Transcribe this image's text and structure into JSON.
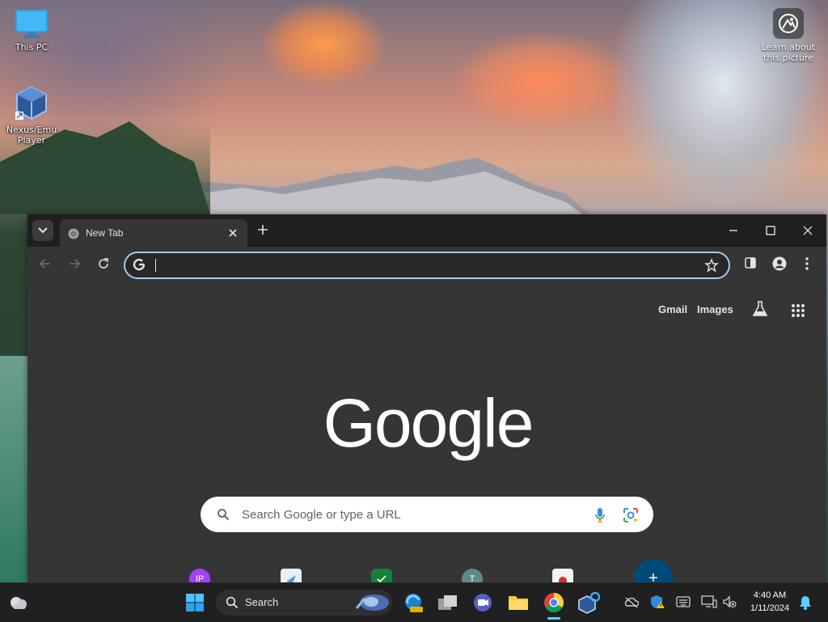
{
  "desktop": {
    "icons": [
      {
        "label": "This PC"
      },
      {
        "label": "Nexus/Emu Player"
      }
    ],
    "learn_more": "Learn about this picture"
  },
  "browser": {
    "tab_title": "New Tab",
    "omnibox_value": "",
    "top_links": {
      "gmail": "Gmail",
      "images": "Images"
    },
    "logo_text": "Google",
    "search_placeholder": "Search Google or type a URL",
    "shortcuts": [
      {
        "initials": "IP",
        "color": "#a142f4"
      },
      {
        "initials": "",
        "color": "#e8f0fe"
      },
      {
        "initials": "",
        "color": "#188038"
      },
      {
        "initials": "T",
        "color": "#5f8a8a"
      },
      {
        "initials": "",
        "color": "#f1f3f4"
      },
      {
        "initials": "+",
        "color": "#004a77"
      }
    ]
  },
  "taskbar": {
    "search_label": "Search",
    "time": "4:40 AM",
    "date": "1/11/2024"
  }
}
